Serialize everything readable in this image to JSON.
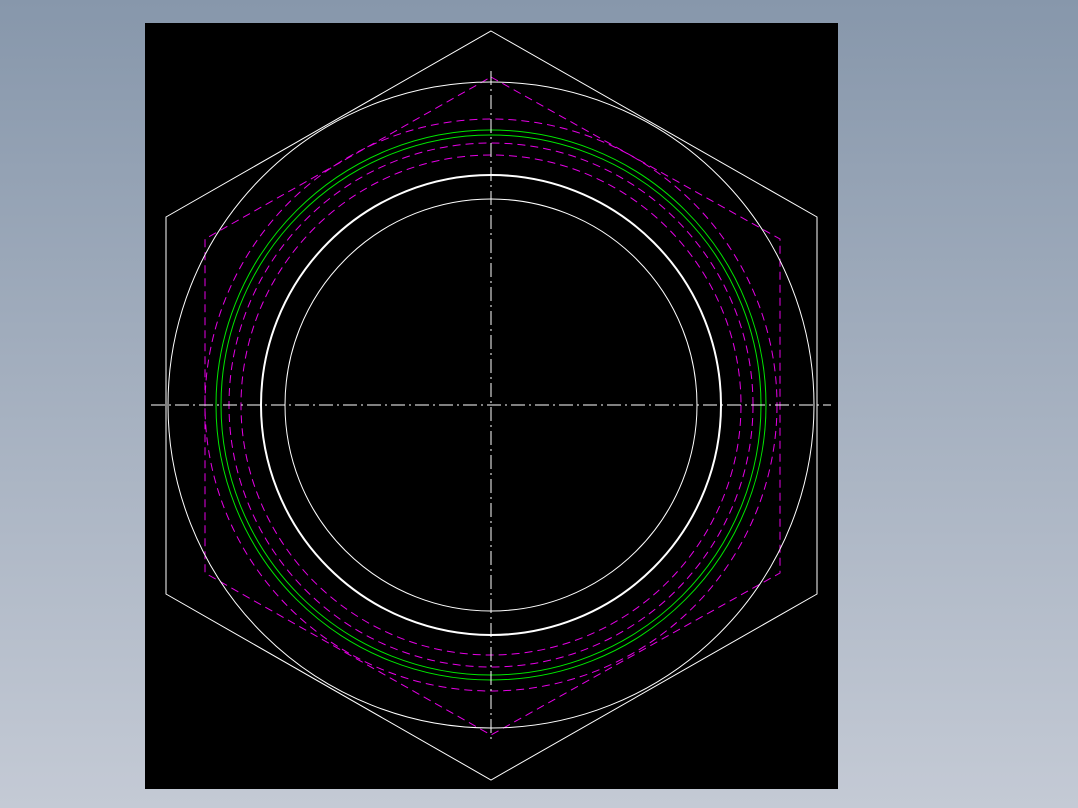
{
  "viewport": {
    "background_top": "#8797ab",
    "background_bottom": "#c4cad5"
  },
  "drawing": {
    "sheet_background": "#000000",
    "colors": {
      "outline": "#ffffff",
      "hidden": "#e600e6",
      "thread": "#00e600",
      "centerline": "#ffffff"
    },
    "line_styles": {
      "outline": "solid",
      "hidden": "dashed",
      "thread": "solid",
      "centerline": "dash-dot"
    }
  }
}
